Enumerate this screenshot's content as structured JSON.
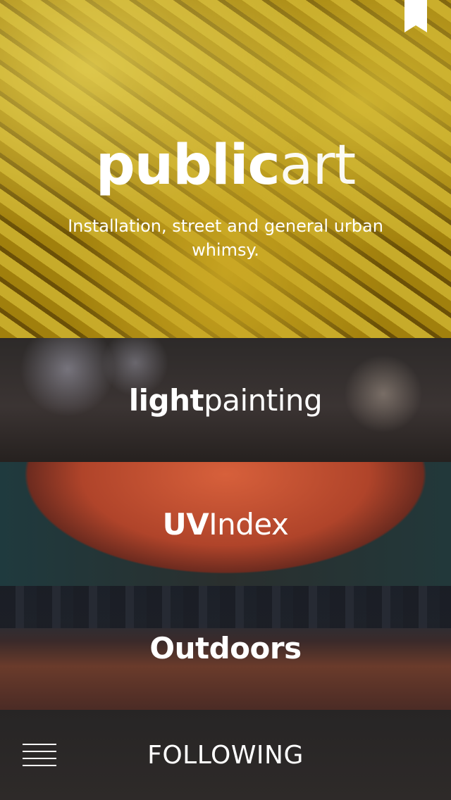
{
  "hero": {
    "title_bold": "public",
    "title_light": "art",
    "subtitle": "Installation, street and general urban whimsy."
  },
  "categories": [
    {
      "bold": "light",
      "light": "painting"
    },
    {
      "bold": "UV",
      "light": "Index"
    },
    {
      "bold": "Outdoors",
      "light": ""
    }
  ],
  "footer": {
    "label": "FOLLOWING"
  },
  "icons": {
    "bookmark": "bookmark-icon",
    "menu": "hamburger-menu-icon"
  },
  "colors": {
    "text": "#ffffff",
    "footer_bg": "#2a2727",
    "hero_accent": "#d9b725"
  }
}
